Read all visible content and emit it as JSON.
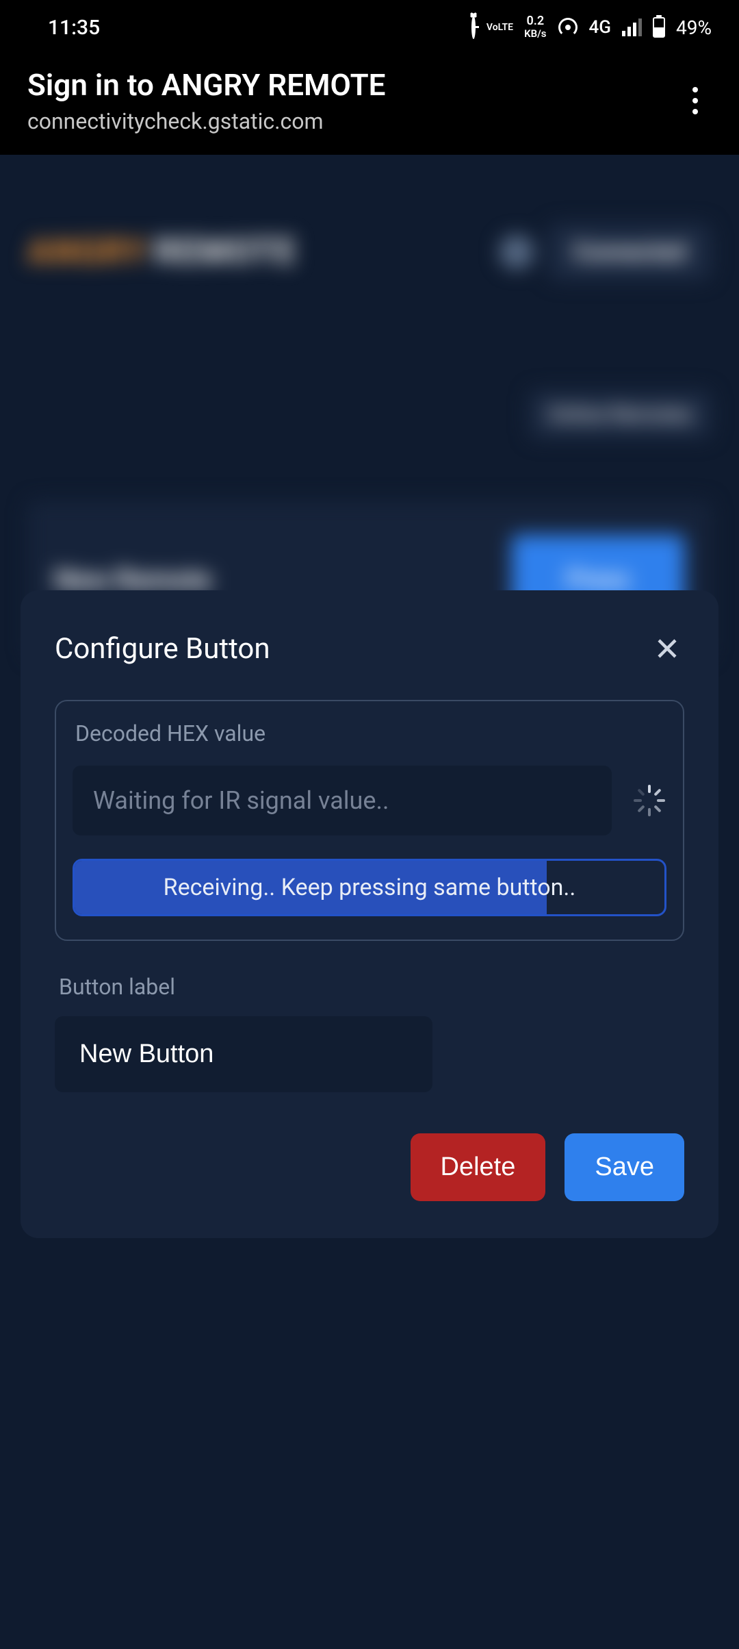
{
  "statusbar": {
    "time": "11:35",
    "volte": "VoLTE",
    "data_rate_top": "0.2",
    "data_rate_bottom": "KB/s",
    "network": "4G",
    "battery_pct": "49%"
  },
  "header": {
    "title": "Sign in to ANGRY REMOTE",
    "subtitle": "connectivitycheck.gstatic.com"
  },
  "backdrop": {
    "logo_part1": "ANGRY",
    "logo_part2": "REMOTE",
    "connected_chip": "Connected",
    "online_remotes_chip": "Online Remotes",
    "card_title": "New Remote",
    "press_label": "Press"
  },
  "modal": {
    "title": "Configure Button",
    "hex_section_label": "Decoded HEX value",
    "hex_placeholder": "Waiting for IR signal value..",
    "progress_text": "Receiving.. Keep pressing same button..",
    "label_section_label": "Button label",
    "label_value": "New Button",
    "delete_label": "Delete",
    "save_label": "Save"
  }
}
